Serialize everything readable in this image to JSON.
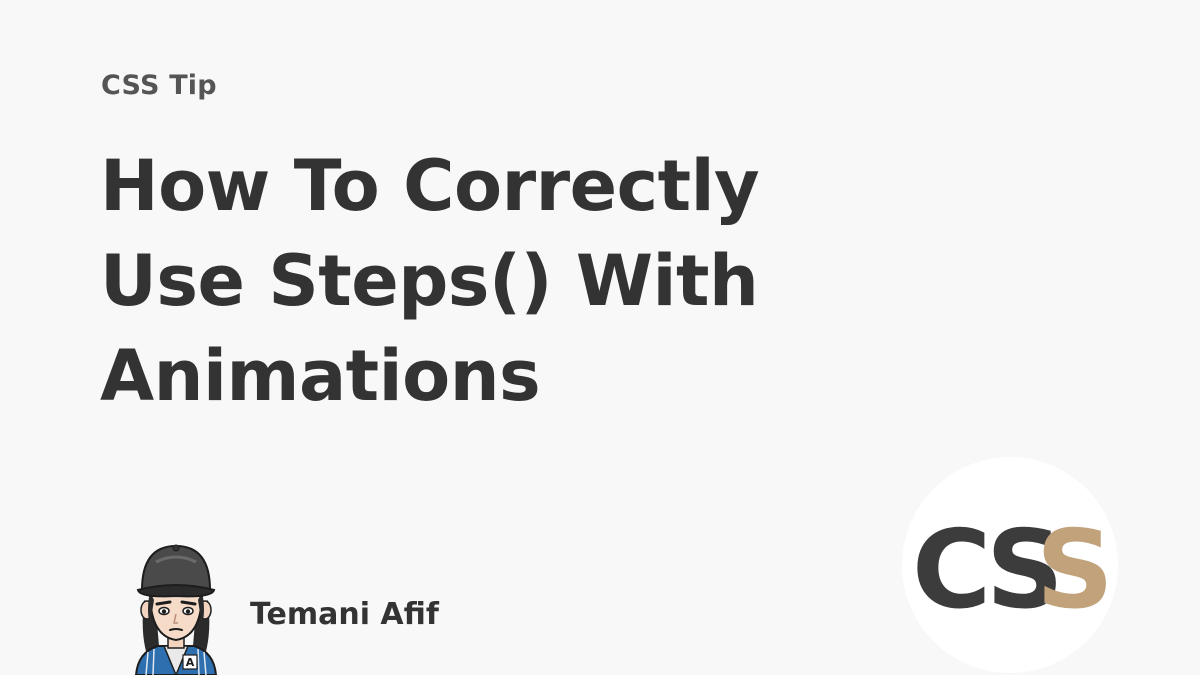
{
  "card": {
    "eyebrow": "CSS Tip",
    "title_lines": [
      "How To Correctly",
      "Use Steps() With",
      "Animations"
    ]
  },
  "author": {
    "name": "Temani Afif",
    "avatar_badge": "A"
  },
  "logo": {
    "letters": [
      "C",
      "S",
      "S"
    ],
    "primary_color": "#3c3c3c",
    "accent_color": "#c1a27b"
  },
  "colors": {
    "background": "#f8f8f8",
    "text": "#333333",
    "eyebrow": "#555555"
  }
}
